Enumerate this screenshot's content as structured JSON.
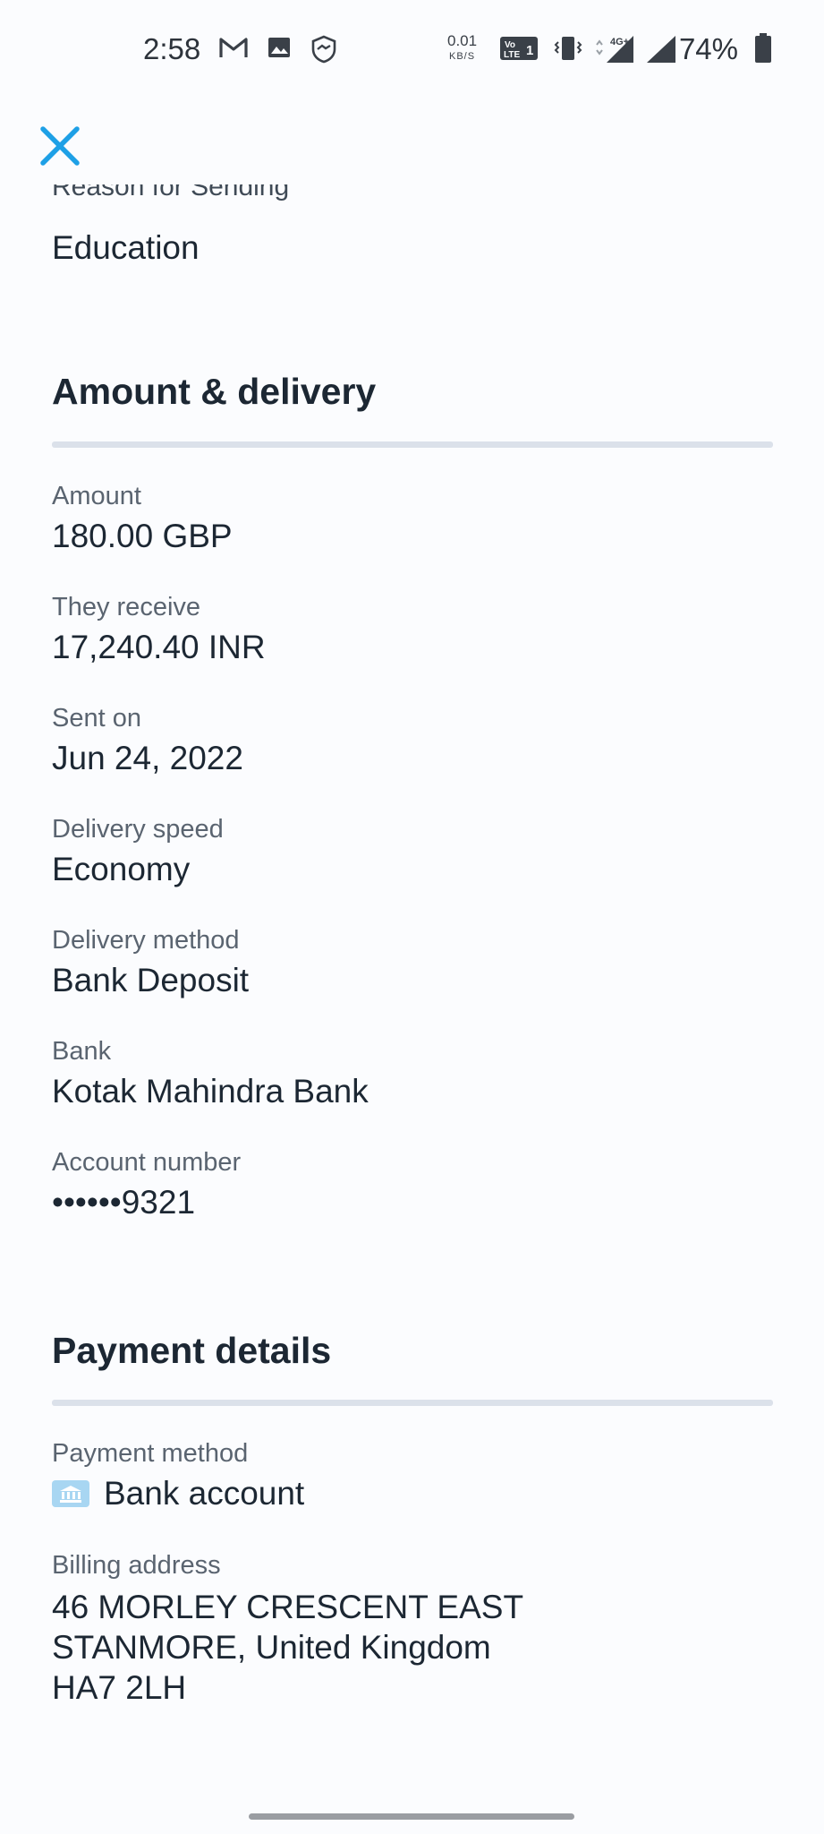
{
  "status_bar": {
    "time": "2:58",
    "net_speed_value": "0.01",
    "net_speed_unit": "KB/S",
    "battery": "74%",
    "network_type": "4G+",
    "volte_label": "Vo LTE 1"
  },
  "header": {
    "close_icon": "close-icon"
  },
  "clipped_label": "Reason for Sending",
  "reason_value": "Education",
  "amount_section": {
    "title": "Amount & delivery",
    "fields": [
      {
        "label": "Amount",
        "value": "180.00 GBP"
      },
      {
        "label": "They receive",
        "value": "17,240.40 INR"
      },
      {
        "label": "Sent on",
        "value": "Jun 24, 2022"
      },
      {
        "label": "Delivery speed",
        "value": "Economy"
      },
      {
        "label": "Delivery method",
        "value": "Bank Deposit"
      },
      {
        "label": "Bank",
        "value": "Kotak Mahindra Bank"
      },
      {
        "label": "Account number",
        "value": "••••••9321"
      }
    ]
  },
  "payment_section": {
    "title": "Payment details",
    "payment_method_label": "Payment method",
    "payment_method_value": "Bank account",
    "payment_method_icon": "bank-icon",
    "billing_label": "Billing address",
    "billing_lines": [
      "46 MORLEY CRESCENT EAST",
      "STANMORE, United Kingdom",
      "HA7 2LH"
    ]
  },
  "colors": {
    "accent": "#1ea0e6",
    "text": "#1c2733",
    "muted": "#5a6470",
    "divider": "#dbe1ea"
  }
}
